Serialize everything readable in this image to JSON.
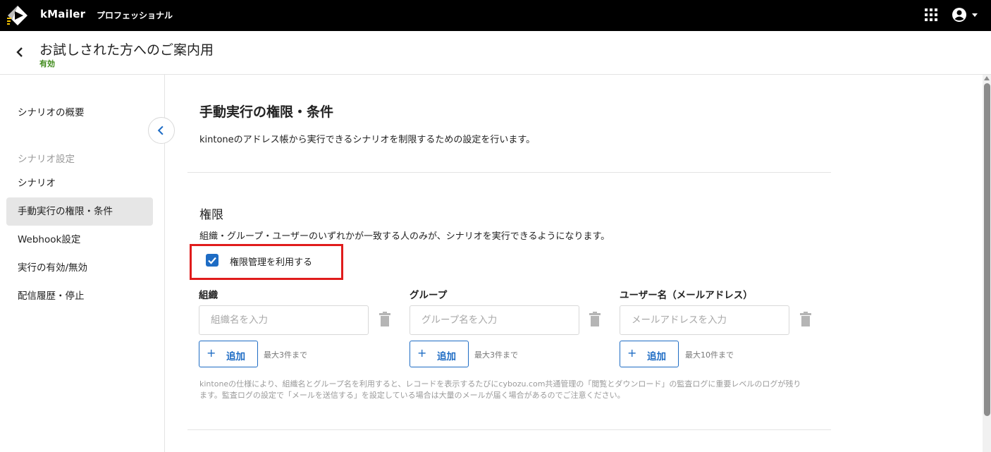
{
  "header": {
    "brand": "kMailer",
    "edition": "プロフェッショナル",
    "logo_icon": "kmailer-logo-icon",
    "apps_icon": "apps-grid-icon",
    "user_icon": "account-circle-icon"
  },
  "titlebar": {
    "title": "お試しされた方へのご案内用",
    "status": "有効",
    "status_color": "#3f8a1a"
  },
  "sidebar": {
    "overview": "シナリオの概要",
    "group_label": "シナリオ設定",
    "items": [
      {
        "label": "シナリオ"
      },
      {
        "label": "手動実行の権限・条件",
        "active": true
      },
      {
        "label": "Webhook設定"
      },
      {
        "label": "実行の有効/無効"
      },
      {
        "label": "配信履歴・停止"
      }
    ]
  },
  "main": {
    "title": "手動実行の権限・条件",
    "description": "kintoneのアドレス帳から実行できるシナリオを制限するための設定を行います。",
    "permission": {
      "heading": "権限",
      "description": "組織・グループ・ユーザーのいずれかが一致する人のみが、シナリオを実行できるようになります。",
      "checkbox_label": "権限管理を利用する",
      "checkbox_checked": true,
      "columns": [
        {
          "label": "組織",
          "placeholder": "組織名を入力",
          "add_label": "追加",
          "limit": "最大3件まで"
        },
        {
          "label": "グループ",
          "placeholder": "グループ名を入力",
          "add_label": "追加",
          "limit": "最大3件まで"
        },
        {
          "label": "ユーザー名（メールアドレス）",
          "placeholder": "メールアドレスを入力",
          "add_label": "追加",
          "limit": "最大10件まで"
        }
      ],
      "note": "kintoneの仕様により、組織名とグループ名を利用すると、レコードを表示するたびにcybozu.com共通管理の「閲覧とダウンロード」の監査ログに重要レベルのログが残ります。監査ログの設定で「メールを送信する」を設定している場合は大量のメールが届く場合があるのでご注意ください。"
    }
  },
  "colors": {
    "accent": "#1e6cc4",
    "highlight": "#e01c1c",
    "topbar": "#000000"
  }
}
